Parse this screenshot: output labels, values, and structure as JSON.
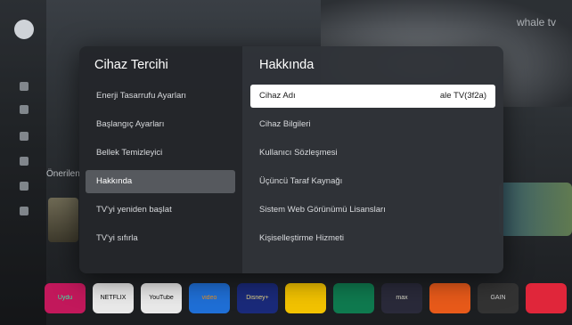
{
  "background": {
    "brand": "whale tv",
    "section_label": "Önerilen",
    "app_tiles": [
      {
        "name": "Uydu",
        "color": "#c2185b"
      },
      {
        "name": "NETFLIX",
        "color": "#e9e9e9"
      },
      {
        "name": "YouTube",
        "color": "#e9e9e9"
      },
      {
        "name": "video",
        "color": "#1f6fd6"
      },
      {
        "name": "Disney+",
        "color": "#1a2a7a"
      },
      {
        "name": "",
        "color": "#f2c200"
      },
      {
        "name": "",
        "color": "#0f7a4f"
      },
      {
        "name": "max",
        "color": "#2a2a3a"
      },
      {
        "name": "",
        "color": "#e85a1a"
      },
      {
        "name": "GAIN",
        "color": "#333333"
      },
      {
        "name": "",
        "color": "#e0263a"
      }
    ]
  },
  "dialog": {
    "left": {
      "title": "Cihaz Tercihi",
      "items": [
        {
          "label": "Enerji Tasarrufu Ayarları"
        },
        {
          "label": "Başlangıç Ayarları"
        },
        {
          "label": "Bellek Temizleyici"
        },
        {
          "label": "Hakkında",
          "active": true
        },
        {
          "label": "TV'yi yeniden başlat"
        },
        {
          "label": "TV'yi sıfırla"
        }
      ]
    },
    "right": {
      "title": "Hakkında",
      "items": [
        {
          "label": "Cihaz Adı",
          "value": "ale TV(3f2a)",
          "focused": true
        },
        {
          "label": "Cihaz Bilgileri"
        },
        {
          "label": "Kullanıcı Sözleşmesi"
        },
        {
          "label": "Üçüncü Taraf Kaynağı"
        },
        {
          "label": "Sistem Web Görünümü Lisansları"
        },
        {
          "label": "Kişiselleştirme Hizmeti"
        }
      ]
    }
  },
  "colors": {
    "focus": "#ffffff",
    "active": "#56595e"
  }
}
